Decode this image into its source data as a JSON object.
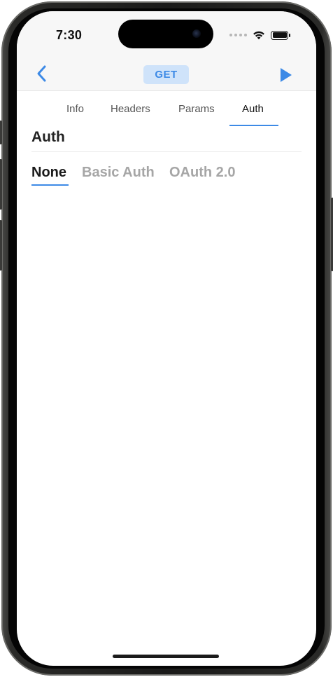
{
  "status_bar": {
    "time": "7:30",
    "icons": [
      "signal-dots-icon",
      "wifi-icon",
      "battery-icon"
    ]
  },
  "nav_bar": {
    "back_icon": "chevron-left-icon",
    "method": "GET",
    "run_icon": "play-icon",
    "accent_color": "#3d8ae6"
  },
  "tabs": [
    {
      "label": "Info"
    },
    {
      "label": "Headers"
    },
    {
      "label": "Params"
    },
    {
      "label": "Auth"
    }
  ],
  "active_tab": "Auth",
  "section": {
    "title": "Auth"
  },
  "auth_options": [
    {
      "label": "None"
    },
    {
      "label": "Basic Auth"
    },
    {
      "label": "OAuth 2.0"
    }
  ],
  "selected_auth": "None"
}
